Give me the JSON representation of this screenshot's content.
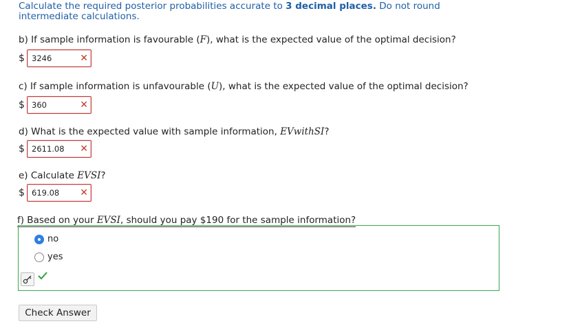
{
  "instructions": {
    "part1": "Calculate the required posterior probabilities accurate to ",
    "bold": "3 decimal places.",
    "part2": " Do not round intermediate calculations."
  },
  "questions": [
    {
      "prefix": "b) If sample information is favourable (",
      "math": "F",
      "suffix": "), what is the expected value of the optimal decision?",
      "currency": "$",
      "value": "3246",
      "status": "incorrect"
    },
    {
      "prefix": "c) If sample information is unfavourable (",
      "math": "U",
      "suffix": "), what is the expected value of the optimal decision?",
      "currency": "$",
      "value": "360",
      "status": "incorrect"
    },
    {
      "prefix": "d) What is the expected value with sample information, ",
      "math": "EVwithSI",
      "suffix": "?",
      "currency": "$",
      "value": "2611.08",
      "status": "incorrect"
    },
    {
      "prefix": "e) Calculate ",
      "math": "EVSI",
      "suffix": "?",
      "currency": "$",
      "value": "619.08",
      "status": "incorrect"
    }
  ],
  "question_f": {
    "prefix": "f) Based on your ",
    "math": "EVSI",
    "suffix": ", should you pay $190 for the sample information?",
    "options": [
      {
        "label": "no",
        "selected": true
      },
      {
        "label": "yes",
        "selected": false
      }
    ],
    "status": "correct"
  },
  "icons": {
    "incorrect": "x-icon",
    "correct": "checkmark-icon",
    "key": "key-icon"
  },
  "colors": {
    "accent": "#1f5fa6",
    "incorrect": "#c0392b",
    "correct": "#3aa64c",
    "radio_selected": "#2f7fe0"
  },
  "check_button_label": "Check Answer"
}
